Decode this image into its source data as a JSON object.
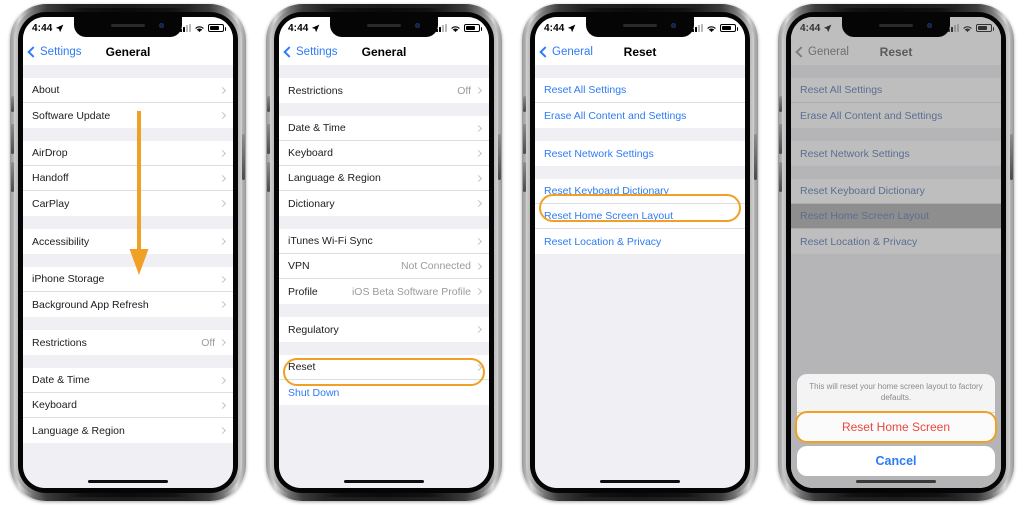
{
  "meta": {
    "status_time": "4:44",
    "accent_orange": "#f0a024",
    "ios_blue": "#2d7cf6",
    "destructive_red": "#e8483f",
    "list_bg": "#efeff4"
  },
  "phones": [
    {
      "id": "phone-1",
      "nav": {
        "back_label": "Settings",
        "title": "General"
      },
      "annotation": {
        "type": "down-arrow",
        "color": "#f0a024"
      },
      "groups": [
        {
          "rows": [
            {
              "label": "About",
              "value": "",
              "chevron": true,
              "style": "plain"
            },
            {
              "label": "Software Update",
              "value": "",
              "chevron": true,
              "style": "plain"
            }
          ]
        },
        {
          "rows": [
            {
              "label": "AirDrop",
              "value": "",
              "chevron": true,
              "style": "plain"
            },
            {
              "label": "Handoff",
              "value": "",
              "chevron": true,
              "style": "plain"
            },
            {
              "label": "CarPlay",
              "value": "",
              "chevron": true,
              "style": "plain"
            }
          ]
        },
        {
          "rows": [
            {
              "label": "Accessibility",
              "value": "",
              "chevron": true,
              "style": "plain"
            }
          ]
        },
        {
          "rows": [
            {
              "label": "iPhone Storage",
              "value": "",
              "chevron": true,
              "style": "plain"
            },
            {
              "label": "Background App Refresh",
              "value": "",
              "chevron": true,
              "style": "plain"
            }
          ]
        },
        {
          "rows": [
            {
              "label": "Restrictions",
              "value": "Off",
              "chevron": true,
              "style": "plain"
            }
          ]
        },
        {
          "rows": [
            {
              "label": "Date & Time",
              "value": "",
              "chevron": true,
              "style": "plain"
            },
            {
              "label": "Keyboard",
              "value": "",
              "chevron": true,
              "style": "plain"
            },
            {
              "label": "Language & Region",
              "value": "",
              "chevron": true,
              "style": "plain"
            }
          ]
        }
      ]
    },
    {
      "id": "phone-2",
      "nav": {
        "back_label": "Settings",
        "title": "General"
      },
      "annotation": {
        "type": "ring",
        "target": "Reset",
        "color": "#f0a024"
      },
      "groups": [
        {
          "rows": [
            {
              "label": "Restrictions",
              "value": "Off",
              "chevron": true,
              "style": "plain"
            }
          ]
        },
        {
          "rows": [
            {
              "label": "Date & Time",
              "value": "",
              "chevron": true,
              "style": "plain"
            },
            {
              "label": "Keyboard",
              "value": "",
              "chevron": true,
              "style": "plain"
            },
            {
              "label": "Language & Region",
              "value": "",
              "chevron": true,
              "style": "plain"
            },
            {
              "label": "Dictionary",
              "value": "",
              "chevron": true,
              "style": "plain"
            }
          ]
        },
        {
          "rows": [
            {
              "label": "iTunes Wi-Fi Sync",
              "value": "",
              "chevron": true,
              "style": "plain"
            },
            {
              "label": "VPN",
              "value": "Not Connected",
              "chevron": true,
              "style": "plain"
            },
            {
              "label": "Profile",
              "value": "iOS Beta Software Profile",
              "chevron": true,
              "style": "plain"
            }
          ]
        },
        {
          "rows": [
            {
              "label": "Regulatory",
              "value": "",
              "chevron": true,
              "style": "plain"
            }
          ]
        },
        {
          "rows": [
            {
              "label": "Reset",
              "value": "",
              "chevron": true,
              "style": "plain"
            },
            {
              "label": "Shut Down",
              "value": "",
              "chevron": false,
              "style": "link"
            }
          ]
        }
      ]
    },
    {
      "id": "phone-3",
      "nav": {
        "back_label": "General",
        "title": "Reset"
      },
      "annotation": {
        "type": "ring",
        "target": "Reset Home Screen Layout",
        "color": "#f0a024"
      },
      "groups": [
        {
          "rows": [
            {
              "label": "Reset All Settings",
              "value": "",
              "chevron": false,
              "style": "link"
            },
            {
              "label": "Erase All Content and Settings",
              "value": "",
              "chevron": false,
              "style": "link"
            }
          ]
        },
        {
          "rows": [
            {
              "label": "Reset Network Settings",
              "value": "",
              "chevron": false,
              "style": "link"
            }
          ]
        },
        {
          "rows": [
            {
              "label": "Reset Keyboard Dictionary",
              "value": "",
              "chevron": false,
              "style": "link"
            },
            {
              "label": "Reset Home Screen Layout",
              "value": "",
              "chevron": false,
              "style": "link"
            },
            {
              "label": "Reset Location & Privacy",
              "value": "",
              "chevron": false,
              "style": "link"
            }
          ]
        }
      ]
    },
    {
      "id": "phone-4",
      "nav": {
        "back_label": "General",
        "title": "Reset"
      },
      "dimmed": true,
      "annotation": {
        "type": "ring",
        "target": "Reset Home Screen",
        "color": "#f0a024"
      },
      "groups": [
        {
          "rows": [
            {
              "label": "Reset All Settings",
              "value": "",
              "chevron": false,
              "style": "link"
            },
            {
              "label": "Erase All Content and Settings",
              "value": "",
              "chevron": false,
              "style": "link"
            }
          ]
        },
        {
          "rows": [
            {
              "label": "Reset Network Settings",
              "value": "",
              "chevron": false,
              "style": "link"
            }
          ]
        },
        {
          "rows": [
            {
              "label": "Reset Keyboard Dictionary",
              "value": "",
              "chevron": false,
              "style": "link"
            },
            {
              "label": "Reset Home Screen Layout",
              "value": "",
              "chevron": false,
              "style": "link",
              "pressed": true
            },
            {
              "label": "Reset Location & Privacy",
              "value": "",
              "chevron": false,
              "style": "link"
            }
          ]
        }
      ],
      "action_sheet": {
        "message": "This will reset your home screen layout to factory defaults.",
        "destructive_label": "Reset Home Screen",
        "cancel_label": "Cancel"
      }
    }
  ]
}
